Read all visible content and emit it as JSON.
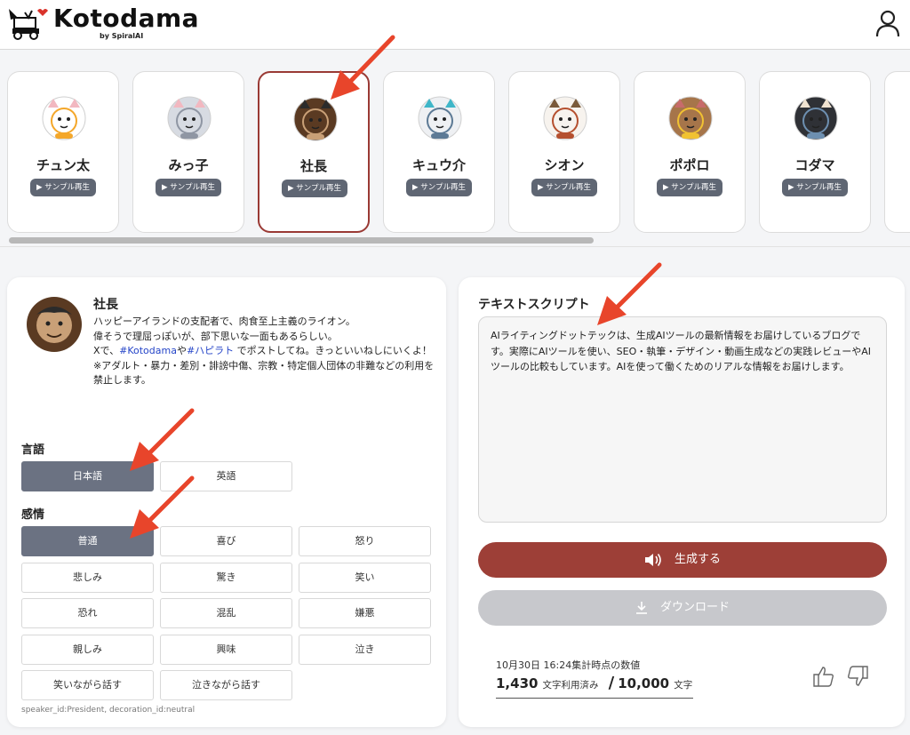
{
  "header": {
    "brand": "Kotodama",
    "brand_sub": "by SpiralAI"
  },
  "characters": [
    {
      "name": "チュン太",
      "sample": "▶ サンプル再生",
      "selected": false,
      "palette": [
        "#ffffff",
        "#f4a72a",
        "#f2b8c0"
      ]
    },
    {
      "name": "みっ子",
      "sample": "▶ サンプル再生",
      "selected": false,
      "palette": [
        "#d7dbe2",
        "#8f96a3",
        "#f2b8c0"
      ]
    },
    {
      "name": "社長",
      "sample": "▶ サンプル再生",
      "selected": true,
      "palette": [
        "#5a3a22",
        "#c9a077",
        "#2b2b2b"
      ]
    },
    {
      "name": "キュウ介",
      "sample": "▶ サンプル再生",
      "selected": false,
      "palette": [
        "#eef0f3",
        "#5d7a95",
        "#3fb6c8"
      ]
    },
    {
      "name": "シオン",
      "sample": "▶ サンプル再生",
      "selected": false,
      "palette": [
        "#f7f3ee",
        "#b5502f",
        "#7a5a3a"
      ]
    },
    {
      "name": "ポポロ",
      "sample": "▶ サンプル再生",
      "selected": false,
      "palette": [
        "#a6754a",
        "#f1c232",
        "#c76b6b"
      ]
    },
    {
      "name": "コダマ",
      "sample": "▶ サンプル再生",
      "selected": false,
      "palette": [
        "#2f3136",
        "#6d8fb0",
        "#f0e3d0"
      ]
    }
  ],
  "profile": {
    "name": "社長",
    "desc_line1": "ハッピーアイランドの支配者で、肉食至上主義のライオン。",
    "desc_line2": "偉そうで理屈っぽいが、部下思いな一面もあるらしい。",
    "desc_x_prefix": "Xで、",
    "desc_tag1": "#Kotodama",
    "desc_mid": "や",
    "desc_tag2": "#ハピラト",
    "desc_x_suffix": " でポストしてね。きっといいねしにいくよ！",
    "desc_notice": "※アダルト・暴力・差別・誹謗中傷、宗教・特定個人団体の非難などの利用を禁止します。"
  },
  "language": {
    "label": "言語",
    "options": [
      "日本語",
      "英語"
    ],
    "active_index": 0
  },
  "emotion": {
    "label": "感情",
    "options": [
      "普通",
      "喜び",
      "怒り",
      "悲しみ",
      "驚き",
      "笑い",
      "恐れ",
      "混乱",
      "嫌悪",
      "親しみ",
      "興味",
      "泣き",
      "笑いながら話す",
      "泣きながら話す"
    ],
    "active_index": 0
  },
  "meta_text": "speaker_id:President, decoration_id:neutral",
  "script": {
    "title": "テキストスクリプト",
    "text": "AIライティングドットテックは、生成AIツールの最新情報をお届けしているブログです。実際にAIツールを使い、SEO・執筆・デザイン・動画生成などの実践レビューやAIツールの比較もしています。AIを使って働くためのリアルな情報をお届けします。"
  },
  "actions": {
    "generate_label": "生成する",
    "download_label": "ダウンロード",
    "generate_icon": "speaker-icon",
    "download_icon": "download-icon"
  },
  "usage": {
    "caption": "10月30日 16:24集計時点の数値",
    "used": "1,430",
    "used_suffix": "文字利用済み",
    "slash": "/",
    "limit": "10,000",
    "limit_suffix": "文字"
  },
  "colors": {
    "accent": "#9d3f37",
    "active_option": "#6b7282",
    "disabled_button": "#c7c8cc",
    "annotation_arrow": "#e8452b"
  }
}
